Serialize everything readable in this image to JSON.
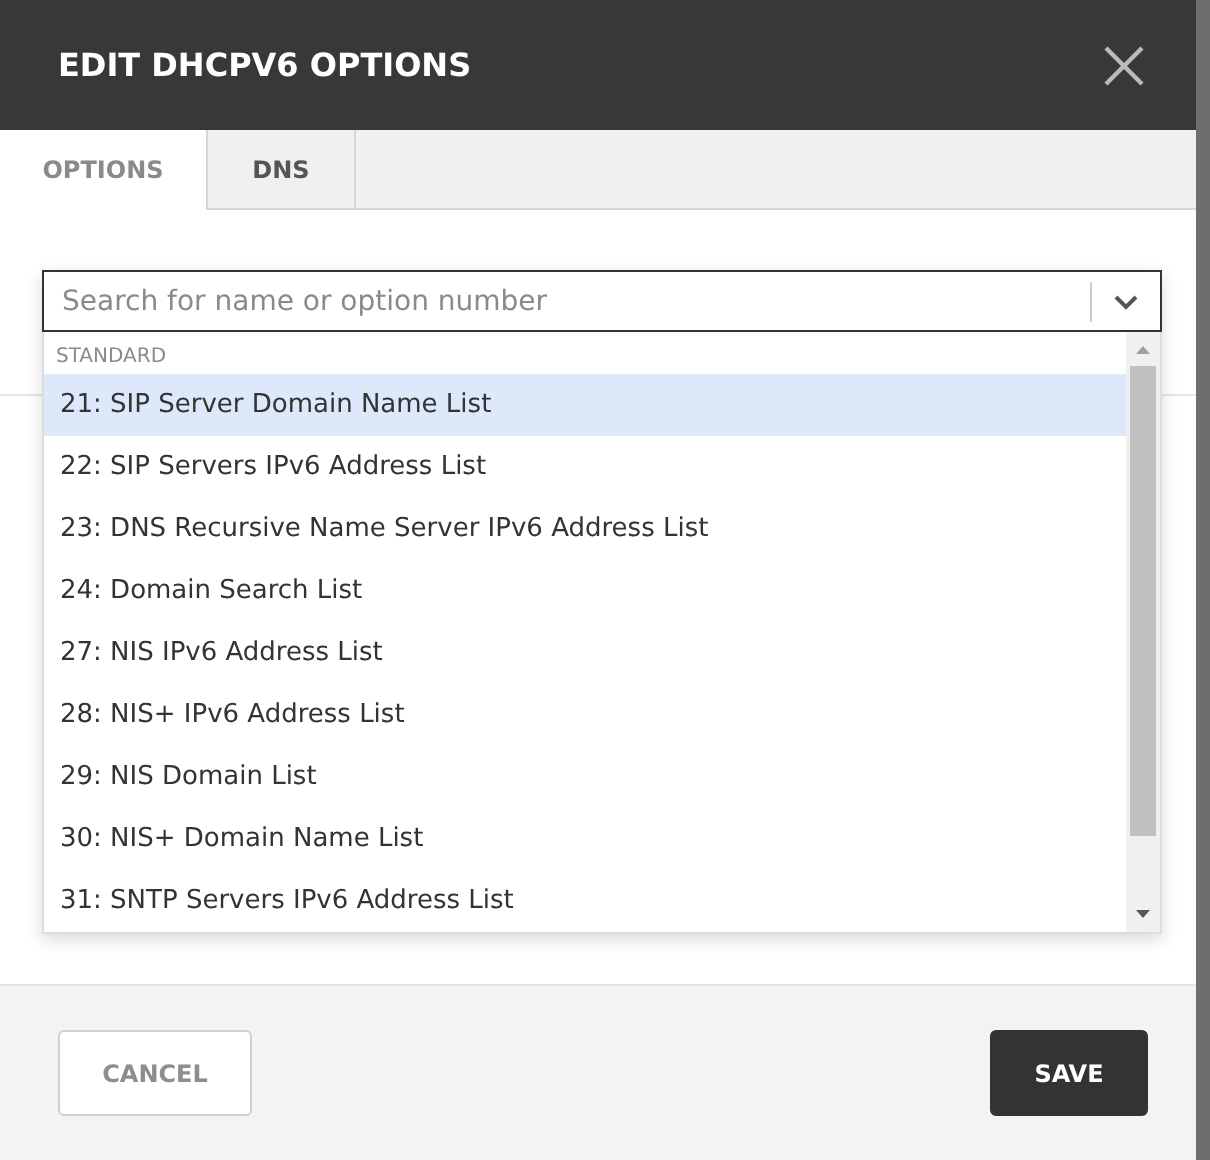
{
  "dialog": {
    "title": "EDIT DHCPV6 OPTIONS"
  },
  "tabs": [
    {
      "label": "OPTIONS",
      "selected": true
    },
    {
      "label": "DNS",
      "selected": false
    }
  ],
  "search": {
    "placeholder": "Search for name or option number"
  },
  "dropdown": {
    "group": "STANDARD",
    "options": [
      {
        "label": "21: SIP Server Domain Name List",
        "selected": true
      },
      {
        "label": "22: SIP Servers IPv6 Address List",
        "selected": false
      },
      {
        "label": "23: DNS Recursive Name Server IPv6 Address List",
        "selected": false
      },
      {
        "label": "24: Domain Search List",
        "selected": false
      },
      {
        "label": "27: NIS IPv6 Address List",
        "selected": false
      },
      {
        "label": "28: NIS+ IPv6 Address List",
        "selected": false
      },
      {
        "label": "29: NIS Domain List",
        "selected": false
      },
      {
        "label": "30: NIS+ Domain Name List",
        "selected": false
      },
      {
        "label": "31: SNTP Servers IPv6 Address List",
        "selected": false
      }
    ]
  },
  "buttons": [
    {
      "label": "CANCEL",
      "kind": "secondary"
    },
    {
      "label": "SAVE",
      "kind": "primary"
    }
  ]
}
